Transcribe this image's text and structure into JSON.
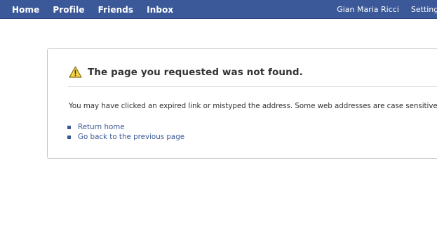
{
  "topbar": {
    "nav_left": [
      "Home",
      "Profile",
      "Friends",
      "Inbox"
    ],
    "user_name": "Gian Maria Ricci",
    "settings_label": "Settings"
  },
  "error": {
    "icon": "warning-triangle-icon",
    "title": "The page you requested was not found.",
    "message": "You may have clicked an expired link or mistyped the address. Some web addresses are case sensitive.",
    "links": [
      "Return home",
      "Go back to the previous page"
    ]
  },
  "colors": {
    "brand": "#3b5998",
    "text": "#333333",
    "warning_fill": "#f5d547"
  }
}
